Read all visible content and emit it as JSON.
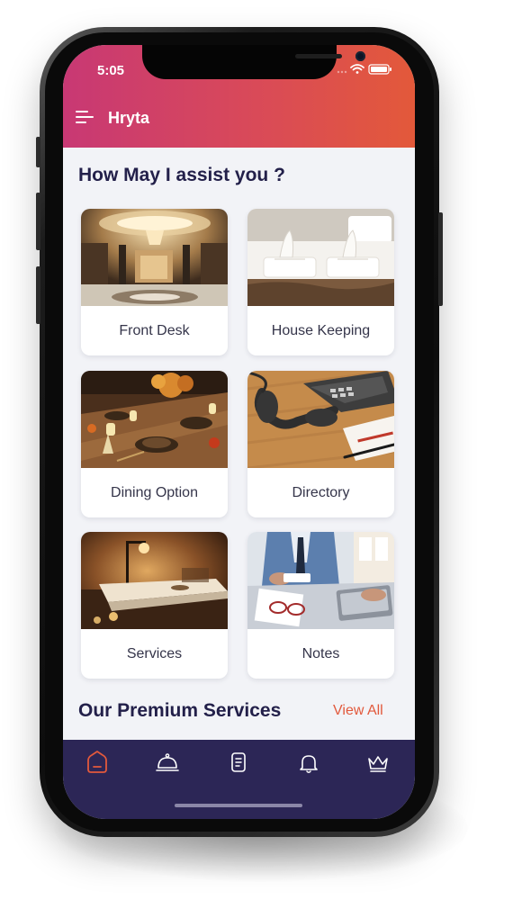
{
  "status_bar": {
    "time": "5:05"
  },
  "header": {
    "title": "Hryta"
  },
  "main": {
    "section_title": "How May I assist you ?",
    "cards": [
      {
        "label": "Front Desk",
        "image": "hotel-lobby-photo"
      },
      {
        "label": "House Keeping",
        "image": "folded-towels-bed-photo"
      },
      {
        "label": "Dining Option",
        "image": "dining-table-photo"
      },
      {
        "label": "Directory",
        "image": "desk-telephone-photo"
      },
      {
        "label": "Services",
        "image": "spa-room-photo"
      },
      {
        "label": "Notes",
        "image": "person-laptop-notes-photo"
      }
    ],
    "premium_title": "Our Premium Services",
    "view_all": "View All"
  },
  "bottom_nav": {
    "items": [
      {
        "icon": "home-icon",
        "active": true
      },
      {
        "icon": "service-bell-icon",
        "active": false
      },
      {
        "icon": "document-icon",
        "active": false
      },
      {
        "icon": "notification-bell-icon",
        "active": false
      },
      {
        "icon": "crown-icon",
        "active": false
      }
    ]
  },
  "colors": {
    "header_start": "#c83874",
    "header_end": "#e3593a",
    "accent": "#e2593c",
    "nav_background": "#2c2656",
    "title_text": "#23204a"
  }
}
